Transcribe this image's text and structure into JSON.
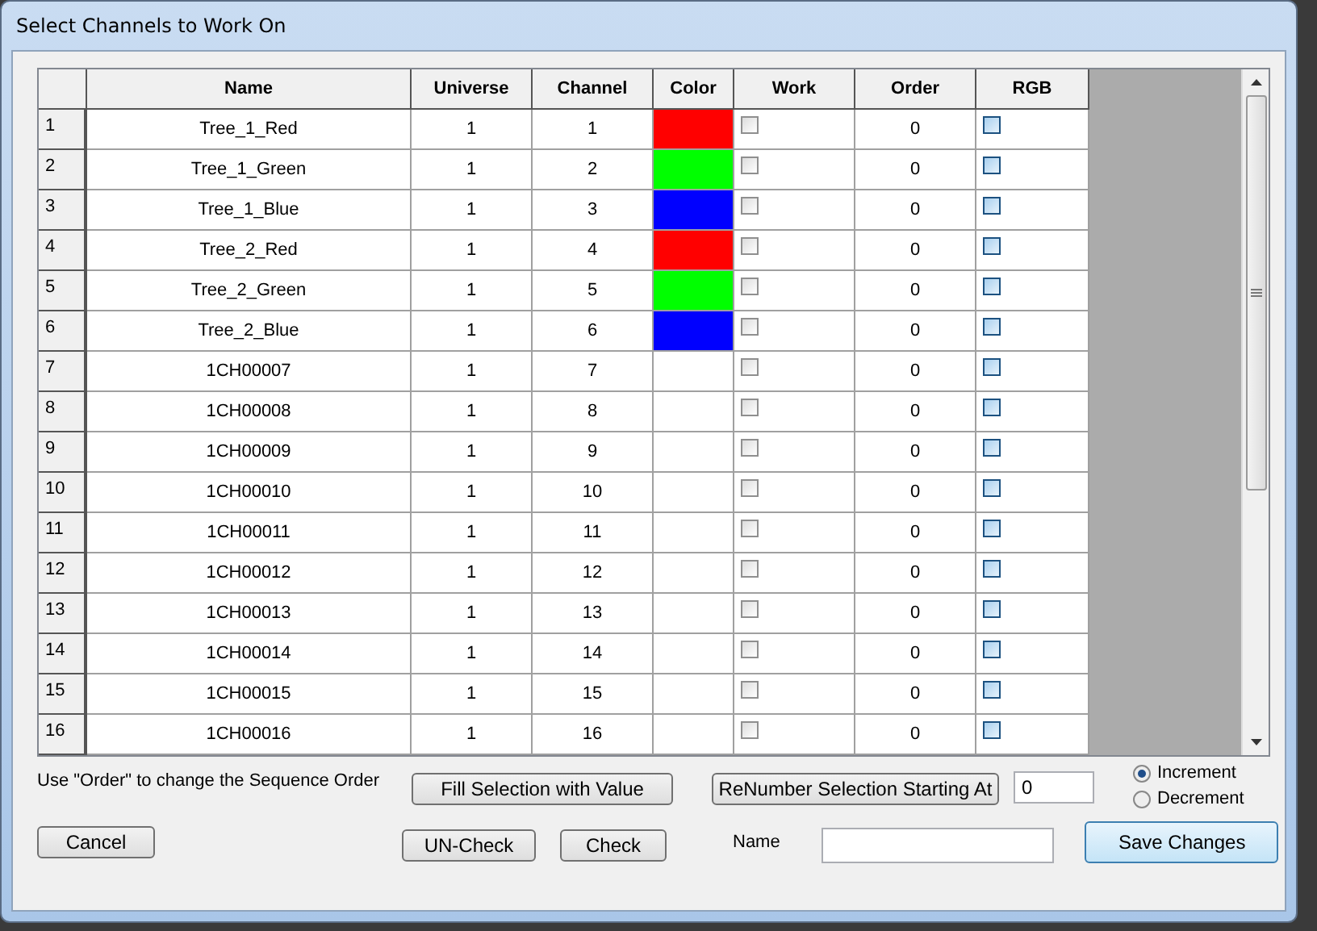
{
  "window": {
    "title": "Select Channels to Work On"
  },
  "table": {
    "columns": [
      "Name",
      "Universe",
      "Channel",
      "Color",
      "Work",
      "Order",
      "RGB"
    ],
    "rows": [
      {
        "index": "1",
        "name": "Tree_1_Red",
        "universe": "1",
        "channel": "1",
        "color": "#ff0000",
        "work": false,
        "order": "0",
        "rgb": false
      },
      {
        "index": "2",
        "name": "Tree_1_Green",
        "universe": "1",
        "channel": "2",
        "color": "#00ff00",
        "work": false,
        "order": "0",
        "rgb": false
      },
      {
        "index": "3",
        "name": "Tree_1_Blue",
        "universe": "1",
        "channel": "3",
        "color": "#0000ff",
        "work": false,
        "order": "0",
        "rgb": false
      },
      {
        "index": "4",
        "name": "Tree_2_Red",
        "universe": "1",
        "channel": "4",
        "color": "#ff0000",
        "work": false,
        "order": "0",
        "rgb": false
      },
      {
        "index": "5",
        "name": "Tree_2_Green",
        "universe": "1",
        "channel": "5",
        "color": "#00ff00",
        "work": false,
        "order": "0",
        "rgb": false
      },
      {
        "index": "6",
        "name": "Tree_2_Blue",
        "universe": "1",
        "channel": "6",
        "color": "#0000ff",
        "work": false,
        "order": "0",
        "rgb": false
      },
      {
        "index": "7",
        "name": "1CH00007",
        "universe": "1",
        "channel": "7",
        "work": false,
        "order": "0",
        "rgb": false
      },
      {
        "index": "8",
        "name": "1CH00008",
        "universe": "1",
        "channel": "8",
        "work": false,
        "order": "0",
        "rgb": false
      },
      {
        "index": "9",
        "name": "1CH00009",
        "universe": "1",
        "channel": "9",
        "work": false,
        "order": "0",
        "rgb": false
      },
      {
        "index": "10",
        "name": "1CH00010",
        "universe": "1",
        "channel": "10",
        "work": false,
        "order": "0",
        "rgb": false
      },
      {
        "index": "11",
        "name": "1CH00011",
        "universe": "1",
        "channel": "11",
        "work": false,
        "order": "0",
        "rgb": false
      },
      {
        "index": "12",
        "name": "1CH00012",
        "universe": "1",
        "channel": "12",
        "work": false,
        "order": "0",
        "rgb": false
      },
      {
        "index": "13",
        "name": "1CH00013",
        "universe": "1",
        "channel": "13",
        "work": false,
        "order": "0",
        "rgb": false
      },
      {
        "index": "14",
        "name": "1CH00014",
        "universe": "1",
        "channel": "14",
        "work": false,
        "order": "0",
        "rgb": false
      },
      {
        "index": "15",
        "name": "1CH00015",
        "universe": "1",
        "channel": "15",
        "work": false,
        "order": "0",
        "rgb": false
      },
      {
        "index": "16",
        "name": "1CH00016",
        "universe": "1",
        "channel": "16",
        "work": false,
        "order": "0",
        "rgb": false
      }
    ]
  },
  "hint": "Use \"Order\" to change the Sequence Order",
  "fill_button": "Fill Selection with Value",
  "renumber_button": "ReNumber Selection Starting At",
  "start_value": "0",
  "direction": [
    {
      "label": "Increment",
      "selected": true
    },
    {
      "label": "Decrement",
      "selected": false
    }
  ],
  "cancel_button": "Cancel",
  "uncheck_button": "UN-Check",
  "check_button": "Check",
  "name_label": "Name",
  "save_button": "Save Changes"
}
